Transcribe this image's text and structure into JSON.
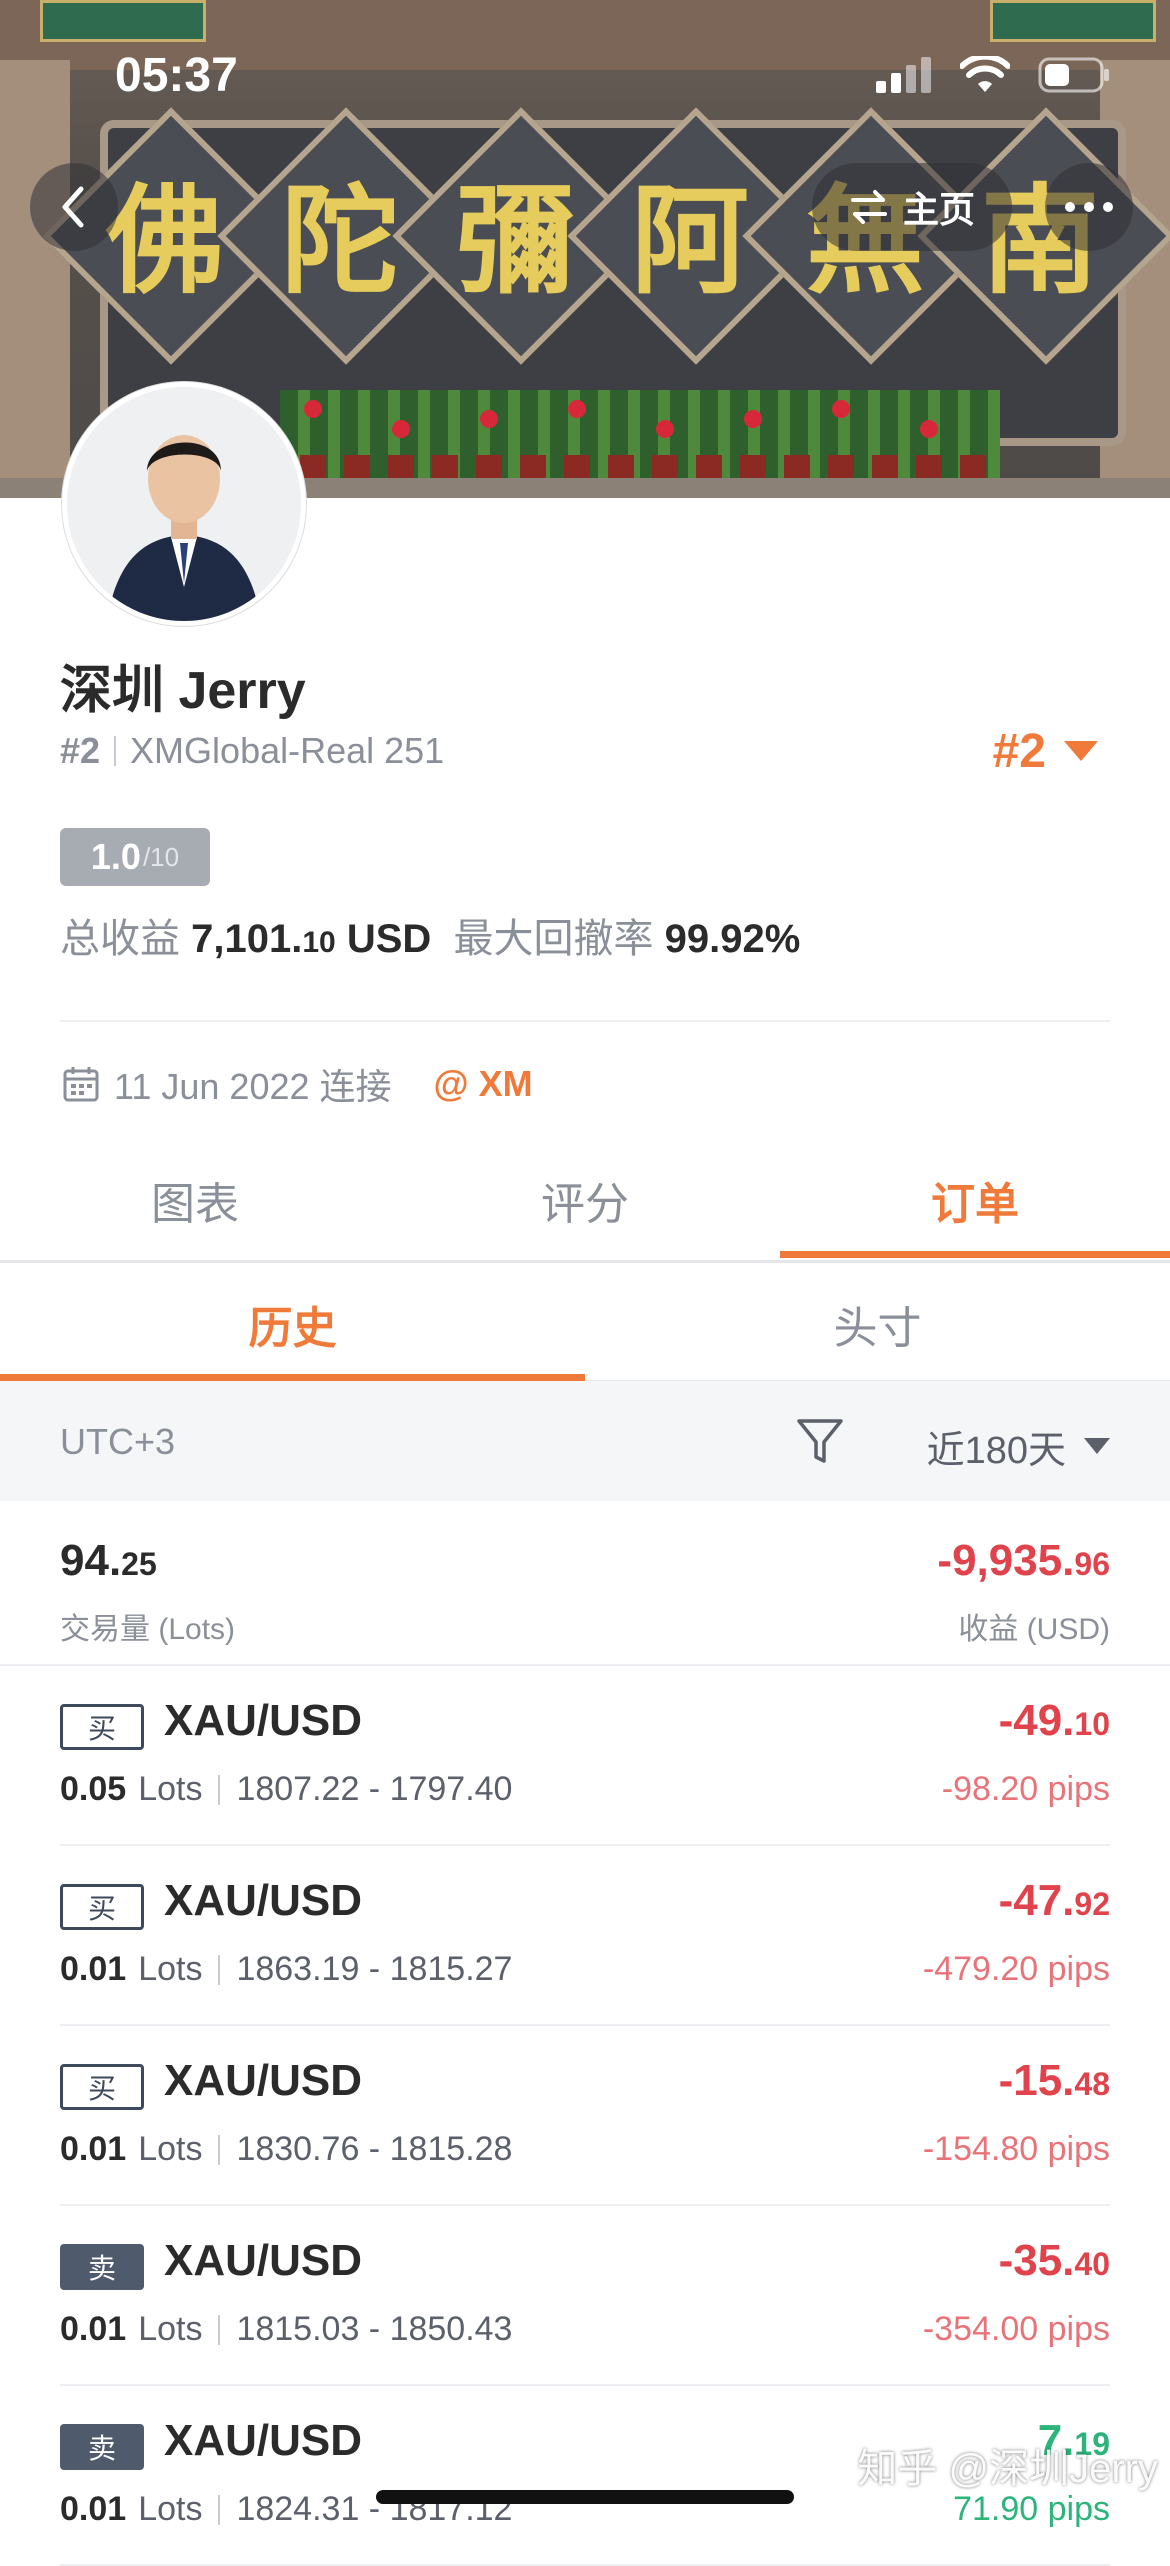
{
  "status_bar": {
    "time": "05:37"
  },
  "header": {
    "banner_text": "佛陀彌阿無南",
    "home_label": "主页"
  },
  "profile": {
    "name": "深圳 Jerry",
    "rank": "#2",
    "account": "XMGlobal-Real 251",
    "rank_badge": "#2",
    "score": "1.0",
    "score_max": "/10",
    "total_profit_label": "总收益",
    "total_profit_main": "7,101.",
    "total_profit_dec": "10",
    "total_profit_unit": "USD",
    "max_drawdown_label": "最大回撤率",
    "max_drawdown_value": "99.92%",
    "connected_date": "11 Jun 2022 连接",
    "broker": "@ XM"
  },
  "tabs": [
    "图表",
    "评分",
    "订单"
  ],
  "active_tab": 2,
  "subtabs": [
    "历史",
    "头寸"
  ],
  "filter": {
    "timezone": "UTC+3",
    "range": "近180天"
  },
  "summary": {
    "volume_main": "94.",
    "volume_dec": "25",
    "volume_label": "交易量 (Lots)",
    "profit_main": "-9,935.",
    "profit_dec": "96",
    "profit_label": "收益 (USD)"
  },
  "orders": [
    {
      "side": "买",
      "type": "buy",
      "symbol": "XAU/USD",
      "lots": "0.05",
      "lots_unit": "Lots",
      "prices": "1807.22 - 1797.40",
      "pnl_main": "-49.",
      "pnl_dec": "10",
      "pips": "-98.20 pips",
      "color": "red"
    },
    {
      "side": "买",
      "type": "buy",
      "symbol": "XAU/USD",
      "lots": "0.01",
      "lots_unit": "Lots",
      "prices": "1863.19 - 1815.27",
      "pnl_main": "-47.",
      "pnl_dec": "92",
      "pips": "-479.20 pips",
      "color": "red"
    },
    {
      "side": "买",
      "type": "buy",
      "symbol": "XAU/USD",
      "lots": "0.01",
      "lots_unit": "Lots",
      "prices": "1830.76 - 1815.28",
      "pnl_main": "-15.",
      "pnl_dec": "48",
      "pips": "-154.80 pips",
      "color": "red"
    },
    {
      "side": "卖",
      "type": "sell",
      "symbol": "XAU/USD",
      "lots": "0.01",
      "lots_unit": "Lots",
      "prices": "1815.03 - 1850.43",
      "pnl_main": "-35.",
      "pnl_dec": "40",
      "pips": "-354.00 pips",
      "color": "red"
    },
    {
      "side": "卖",
      "type": "sell",
      "symbol": "XAU/USD",
      "lots": "0.01",
      "lots_unit": "Lots",
      "prices": "1824.31 - 1817.12",
      "pnl_main": "7.",
      "pnl_dec": "19",
      "pips": "71.90 pips",
      "color": "green"
    }
  ],
  "watermark": "知乎 @深圳Jerry",
  "colors": {
    "accent": "#f07a3a",
    "loss": "#e0434b",
    "gain": "#2db47a"
  }
}
